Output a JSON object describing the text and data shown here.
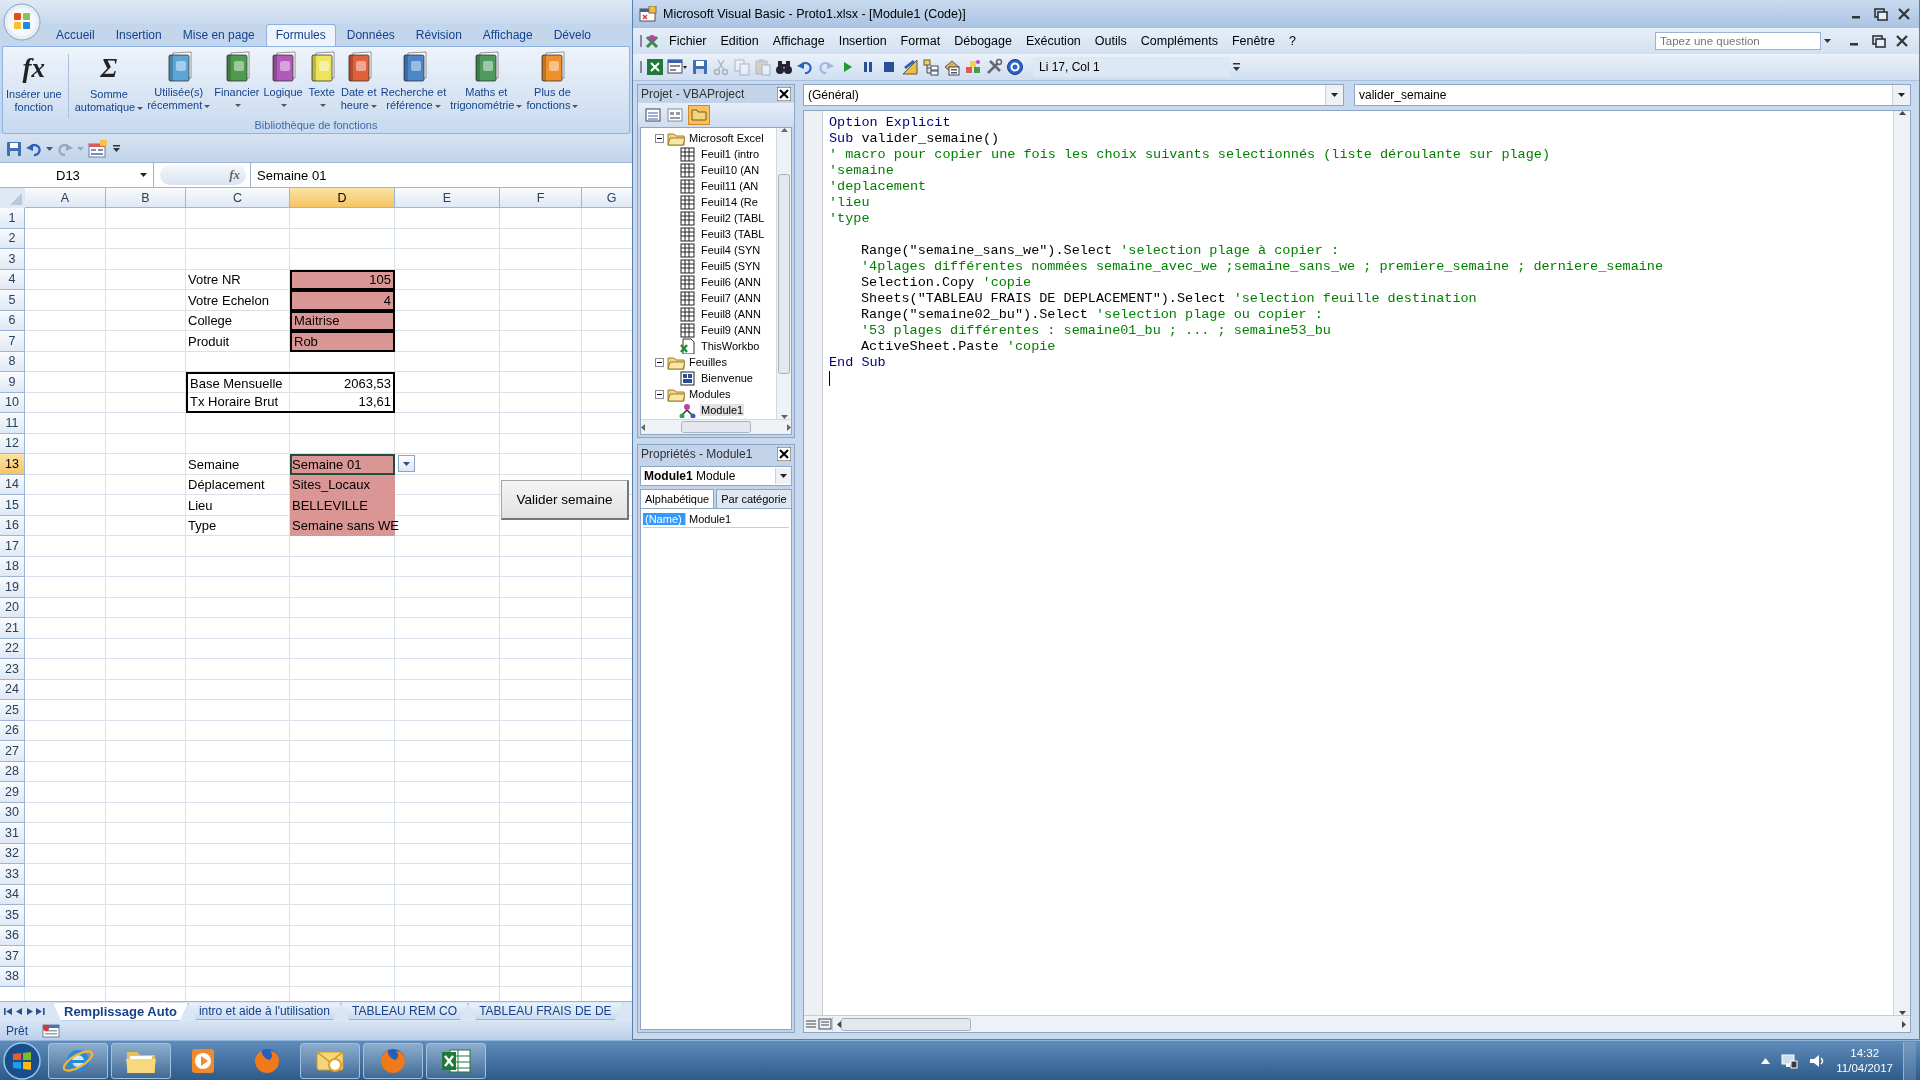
{
  "excel": {
    "ribbon_tabs": [
      {
        "label": "Accueil",
        "selected": false
      },
      {
        "label": "Insertion",
        "selected": false
      },
      {
        "label": "Mise en page",
        "selected": false
      },
      {
        "label": "Formules",
        "selected": true
      },
      {
        "label": "Données",
        "selected": false
      },
      {
        "label": "Révision",
        "selected": false
      },
      {
        "label": "Affichage",
        "selected": false
      },
      {
        "label": "Dévelo",
        "selected": false
      }
    ],
    "ribbon_buttons": [
      {
        "kind": "glyph",
        "glyph": "fx",
        "label": "Insérer une\nfonction",
        "dropdown": false
      },
      {
        "kind": "glyph",
        "glyph": "Σ",
        "label": "Somme\nautomatique",
        "dropdown": true
      },
      {
        "kind": "book",
        "color": "#5aa6d6",
        "label": "Utilisée(s)\nrécemment",
        "dropdown": true
      },
      {
        "kind": "book",
        "color": "#4e9a4e",
        "label": "Financier",
        "dropdown": true
      },
      {
        "kind": "book",
        "color": "#b25ab8",
        "label": "Logique",
        "dropdown": true
      },
      {
        "kind": "book",
        "color": "#ece45a",
        "label": "Texte",
        "dropdown": true
      },
      {
        "kind": "book",
        "color": "#e0603a",
        "label": "Date et\nheure",
        "dropdown": true
      },
      {
        "kind": "book",
        "color": "#4a86c8",
        "label": "Recherche et\nréférence",
        "dropdown": true
      },
      {
        "kind": "book",
        "color": "#4e9a5e",
        "label": "Maths et\ntrigonométrie",
        "dropdown": true
      },
      {
        "kind": "book",
        "color": "#f0902a",
        "label": "Plus de\nfonctions",
        "dropdown": true
      }
    ],
    "group_label": "Bibliothèque de fonctions",
    "name_box": "D13",
    "formula_glyph": "fx",
    "formula": "Semaine 01",
    "columns": [
      {
        "label": "A",
        "selected": false
      },
      {
        "label": "B",
        "selected": false
      },
      {
        "label": "C",
        "selected": false
      },
      {
        "label": "D",
        "selected": true
      },
      {
        "label": "E",
        "selected": false
      },
      {
        "label": "F",
        "selected": false
      },
      {
        "label": "G",
        "selected": false
      }
    ],
    "rows": [
      {
        "number": "1",
        "selected": false
      },
      {
        "number": "2",
        "selected": false
      },
      {
        "number": "3",
        "selected": false
      },
      {
        "number": "4",
        "selected": false,
        "cells": [
          null,
          null,
          {
            "text": "Votre NR"
          },
          {
            "text": "105",
            "input": true,
            "right_aligned": true,
            "bordered": true
          }
        ]
      },
      {
        "number": "5",
        "selected": false,
        "cells": [
          null,
          null,
          {
            "text": "Votre Echelon"
          },
          {
            "text": "4",
            "input": true,
            "right_aligned": true,
            "bordered": true
          }
        ]
      },
      {
        "number": "6",
        "selected": false,
        "cells": [
          null,
          null,
          {
            "text": "College"
          },
          {
            "text": "Maitrise",
            "input": true,
            "bordered": true
          }
        ]
      },
      {
        "number": "7",
        "selected": false,
        "cells": [
          null,
          null,
          {
            "text": "Produit"
          },
          {
            "text": "Rob",
            "input": true,
            "bordered": true
          }
        ]
      },
      {
        "number": "8",
        "selected": false
      },
      {
        "number": "9",
        "selected": false,
        "cells": [
          null,
          null,
          {
            "text": "Base Mensuelle",
            "outlined": true
          },
          {
            "text": "2063,53",
            "right_aligned": true,
            "outlined": true
          }
        ]
      },
      {
        "number": "10",
        "selected": false,
        "cells": [
          null,
          null,
          {
            "text": "Tx Horaire Brut",
            "outlined": true
          },
          {
            "text": "13,61",
            "right_aligned": true,
            "outlined": true
          }
        ]
      },
      {
        "number": "11",
        "selected": false
      },
      {
        "number": "12",
        "selected": false
      },
      {
        "number": "13",
        "selected": true,
        "cells": [
          null,
          null,
          {
            "text": "Semaine"
          },
          {
            "text": "Semaine 01",
            "input": true,
            "active": true,
            "list": true
          }
        ]
      },
      {
        "number": "14",
        "selected": false,
        "cells": [
          null,
          null,
          {
            "text": "Déplacement"
          },
          {
            "text": "Sites_Locaux",
            "input": true
          }
        ]
      },
      {
        "number": "15",
        "selected": false,
        "cells": [
          null,
          null,
          {
            "text": "Lieu"
          },
          {
            "text": "BELLEVILLE",
            "input": true
          }
        ]
      },
      {
        "number": "16",
        "selected": false,
        "cells": [
          null,
          null,
          {
            "text": "Type"
          },
          {
            "text": "Semaine sans WE",
            "input": true
          }
        ]
      },
      {
        "number": "17",
        "selected": false
      },
      {
        "number": "18",
        "selected": false
      },
      {
        "number": "19",
        "selected": false
      },
      {
        "number": "20",
        "selected": false
      },
      {
        "number": "21",
        "selected": false
      },
      {
        "number": "22",
        "selected": false
      },
      {
        "number": "23",
        "selected": false
      },
      {
        "number": "24",
        "selected": false
      },
      {
        "number": "25",
        "selected": false
      },
      {
        "number": "26",
        "selected": false
      },
      {
        "number": "27",
        "selected": false
      },
      {
        "number": "28",
        "selected": false
      },
      {
        "number": "29",
        "selected": false
      },
      {
        "number": "30",
        "selected": false
      },
      {
        "number": "31",
        "selected": false
      },
      {
        "number": "32",
        "selected": false
      },
      {
        "number": "33",
        "selected": false
      },
      {
        "number": "34",
        "selected": false
      },
      {
        "number": "35",
        "selected": false
      },
      {
        "number": "36",
        "selected": false
      },
      {
        "number": "37",
        "selected": false
      },
      {
        "number": "38",
        "selected": false
      }
    ],
    "macro_button": "Valider semaine",
    "sheet_tabs": [
      {
        "label": "Remplissage Auto",
        "selected": true
      },
      {
        "label": "intro et aide à l'utilisation",
        "selected": false
      },
      {
        "label": "TABLEAU REM CO",
        "selected": false
      },
      {
        "label": "TABLEAU FRAIS DE DE",
        "selected": false
      }
    ],
    "status": "Prêt"
  },
  "vba": {
    "title": "Microsoft Visual Basic - Proto1.xlsx - [Module1 (Code)]",
    "menu": [
      "Fichier",
      "Edition",
      "Affichage",
      "Insertion",
      "Format",
      "Débogage",
      "Exécution",
      "Outils",
      "Compléments",
      "Fenêtre",
      "?"
    ],
    "question": {
      "placeholder": "Tapez une question"
    },
    "toolbar": [
      {
        "kind": "excel",
        "disabled": false
      },
      {
        "kind": "userform",
        "disabled": false
      },
      {
        "kind": "save",
        "disabled": false
      },
      {
        "kind": "cut",
        "disabled": true
      },
      {
        "kind": "copy",
        "disabled": true
      },
      {
        "kind": "paste",
        "disabled": true
      },
      {
        "kind": "find",
        "disabled": false
      },
      {
        "kind": "undo",
        "disabled": false
      },
      {
        "kind": "redo",
        "disabled": true
      },
      {
        "kind": "run",
        "disabled": false
      },
      {
        "kind": "pause",
        "disabled": false
      },
      {
        "kind": "stop",
        "disabled": false
      },
      {
        "kind": "design",
        "disabled": false
      },
      {
        "kind": "project",
        "disabled": false
      },
      {
        "kind": "properties",
        "disabled": false
      },
      {
        "kind": "browser",
        "disabled": false
      },
      {
        "kind": "toolbox",
        "disabled": false
      },
      {
        "kind": "help",
        "disabled": false
      }
    ],
    "position": "Li 17, Col 1",
    "project_title": "Projet - VBAProject",
    "tree": [
      {
        "label": "Microsoft Excel",
        "kind": "folder",
        "expanded": true,
        "selected": false,
        "children": [
          {
            "label": "Feuil1 (intro",
            "kind": "sheet",
            "selected": false
          },
          {
            "label": "Feuil10 (AN",
            "kind": "sheet",
            "selected": false
          },
          {
            "label": "Feuil11 (AN",
            "kind": "sheet",
            "selected": false
          },
          {
            "label": "Feuil14 (Re",
            "kind": "sheet",
            "selected": false
          },
          {
            "label": "Feuil2 (TABL",
            "kind": "sheet",
            "selected": false
          },
          {
            "label": "Feuil3 (TABL",
            "kind": "sheet",
            "selected": false
          },
          {
            "label": "Feuil4 (SYN",
            "kind": "sheet",
            "selected": false
          },
          {
            "label": "Feuil5 (SYN",
            "kind": "sheet",
            "selected": false
          },
          {
            "label": "Feuil6 (ANN",
            "kind": "sheet",
            "selected": false
          },
          {
            "label": "Feuil7 (ANN",
            "kind": "sheet",
            "selected": false
          },
          {
            "label": "Feuil8 (ANN",
            "kind": "sheet",
            "selected": false
          },
          {
            "label": "Feuil9 (ANN",
            "kind": "sheet",
            "selected": false
          },
          {
            "label": "ThisWorkbo",
            "kind": "workbook",
            "selected": false
          }
        ]
      },
      {
        "label": "Feuilles",
        "kind": "folder",
        "expanded": true,
        "selected": false,
        "children": [
          {
            "label": "Bienvenue",
            "kind": "form",
            "selected": false
          }
        ]
      },
      {
        "label": "Modules",
        "kind": "folder",
        "expanded": true,
        "selected": false,
        "children": [
          {
            "label": "Module1",
            "kind": "module",
            "selected": true
          }
        ]
      }
    ],
    "properties_title": "Propriétés - Module1",
    "object_combo": "**Module1** Module",
    "property_tabs": [
      {
        "label": "Alphabétique",
        "selected": true
      },
      {
        "label": "Par catégorie",
        "selected": false
      }
    ],
    "properties": [
      {
        "name": "(Name)",
        "value": "Module1",
        "selected": true
      }
    ],
    "object_select": "(Général)",
    "procedure_select": "valider_semaine",
    "code": [
      {
        "segments": [
          {
            "kind": "keyword",
            "text": "Option Explicit"
          }
        ]
      },
      {
        "segments": [
          {
            "kind": "keyword",
            "text": "Sub"
          },
          {
            "kind": "plain",
            "text": " valider_semaine()"
          }
        ]
      },
      {
        "segments": [
          {
            "kind": "comment",
            "text": "' macro pour copier une fois les choix suivants selectionnés (liste déroulante sur plage)"
          }
        ]
      },
      {
        "segments": [
          {
            "kind": "comment",
            "text": "'semaine"
          }
        ]
      },
      {
        "segments": [
          {
            "kind": "comment",
            "text": "'deplacement"
          }
        ]
      },
      {
        "segments": [
          {
            "kind": "comment",
            "text": "'lieu"
          }
        ]
      },
      {
        "segments": [
          {
            "kind": "comment",
            "text": "'type"
          }
        ]
      },
      {
        "gap_before": true,
        "indented": true,
        "segments": [
          {
            "kind": "plain",
            "text": "Range(\"semaine_sans_we\").Select "
          },
          {
            "kind": "comment",
            "text": "'selection plage à copier :"
          }
        ]
      },
      {
        "indented": true,
        "segments": [
          {
            "kind": "comment",
            "text": "'4plages différentes nommées semaine_avec_we ;semaine_sans_we ; premiere_semaine ; derniere_semaine"
          }
        ]
      },
      {
        "indented": true,
        "segments": [
          {
            "kind": "plain",
            "text": "Selection.Copy "
          },
          {
            "kind": "comment",
            "text": "'copie"
          }
        ]
      },
      {
        "indented": true,
        "segments": [
          {
            "kind": "plain",
            "text": "Sheets(\"TABLEAU FRAIS DE DEPLACEMENT\").Select "
          },
          {
            "kind": "comment",
            "text": "'selection feuille destination"
          }
        ]
      },
      {
        "indented": true,
        "segments": [
          {
            "kind": "plain",
            "text": "Range(\"semaine02_bu\").Select "
          },
          {
            "kind": "comment",
            "text": "'selection plage ou copier :"
          }
        ]
      },
      {
        "indented": true,
        "segments": [
          {
            "kind": "comment",
            "text": "'53 plages différentes : semaine01_bu ; ... ; semaine53_bu"
          }
        ]
      },
      {
        "indented": true,
        "segments": [
          {
            "kind": "plain",
            "text": "ActiveSheet.Paste "
          },
          {
            "kind": "comment",
            "text": "'copie"
          }
        ]
      },
      {
        "segments": [
          {
            "kind": "keyword",
            "text": "End Sub"
          }
        ]
      }
    ]
  },
  "taskbar": {
    "apps": [
      {
        "kind": "ie",
        "open": true
      },
      {
        "kind": "explorer",
        "open": true
      },
      {
        "kind": "media",
        "open": false
      },
      {
        "kind": "firefox",
        "open": false
      },
      {
        "kind": "outlook",
        "open": true
      },
      {
        "kind": "firefox",
        "open": true
      },
      {
        "kind": "excel",
        "open": true
      }
    ],
    "time": "14:32",
    "date": "11/04/2017"
  }
}
